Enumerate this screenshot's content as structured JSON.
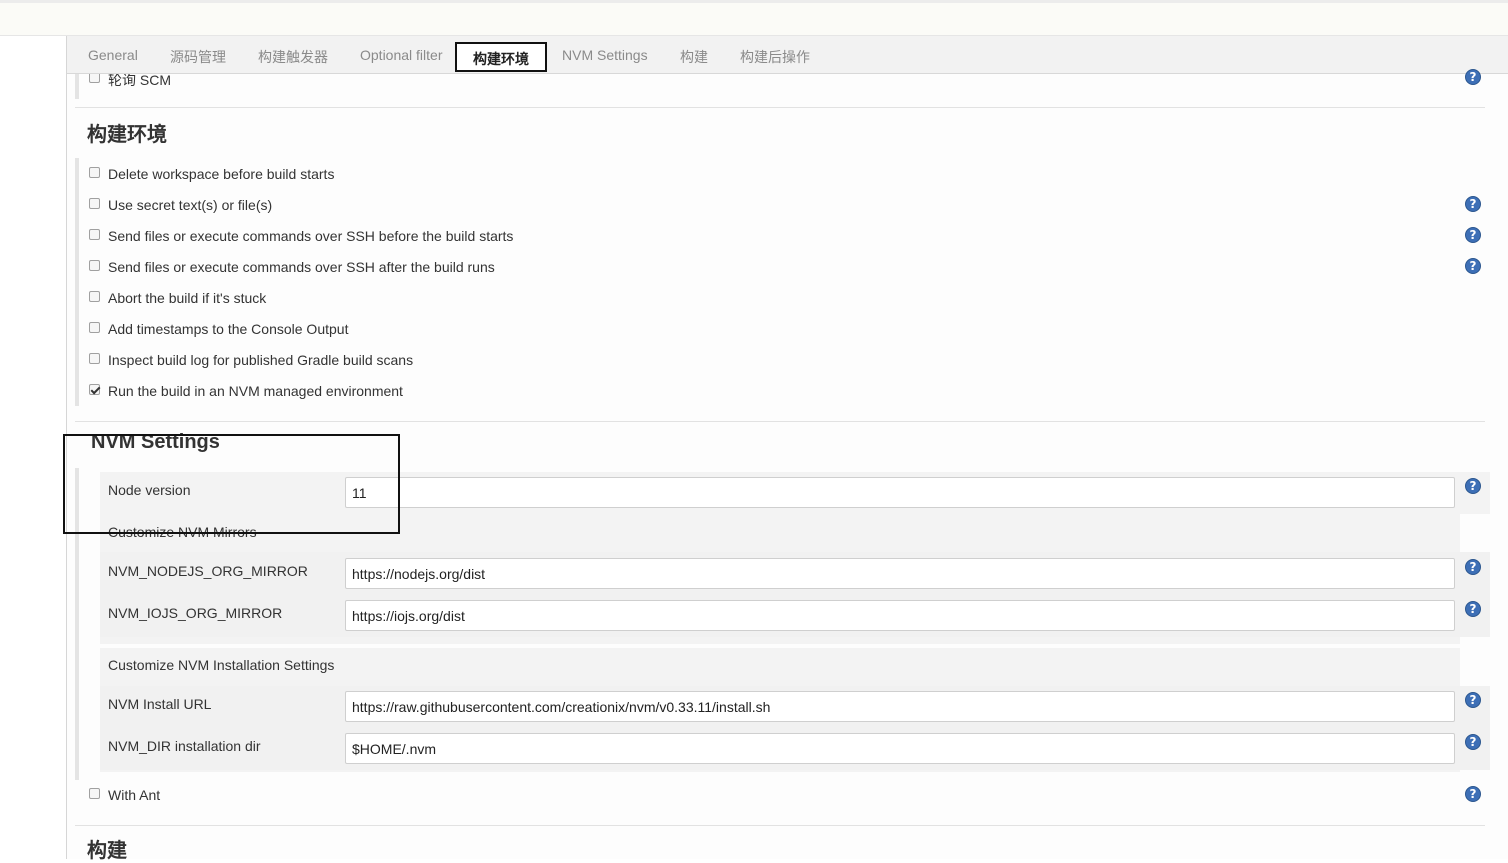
{
  "tabs": [
    "General",
    "源码管理",
    "构建触发器",
    "Optional filter",
    "构建环境",
    "NVM Settings",
    "构建",
    "构建后操作"
  ],
  "poll_scm_label": "轮询 SCM",
  "build_env": {
    "title": "构建环境",
    "options": [
      {
        "label": "Delete workspace before build starts",
        "checked": false
      },
      {
        "label": "Use secret text(s) or file(s)",
        "checked": false
      },
      {
        "label": "Send files or execute commands over SSH before the build starts",
        "checked": false
      },
      {
        "label": "Send files or execute commands over SSH after the build runs",
        "checked": false
      },
      {
        "label": "Abort the build if it's stuck",
        "checked": false
      },
      {
        "label": "Add timestamps to the Console Output",
        "checked": false
      },
      {
        "label": "Inspect build log for published Gradle build scans",
        "checked": false
      },
      {
        "label": "Run the build in an NVM managed environment",
        "checked": true
      }
    ]
  },
  "nvm": {
    "title": "NVM Settings",
    "node_version_label": "Node version",
    "node_version_value": "11",
    "mirrors_heading": "Customize NVM Mirrors",
    "nodejs_mirror_label": "NVM_NODEJS_ORG_MIRROR",
    "nodejs_mirror_value": "https://nodejs.org/dist",
    "iojs_mirror_label": "NVM_IOJS_ORG_MIRROR",
    "iojs_mirror_value": "https://iojs.org/dist",
    "install_heading": "Customize NVM Installation Settings",
    "install_url_label": "NVM Install URL",
    "install_url_value": "https://raw.githubusercontent.com/creationix/nvm/v0.33.11/install.sh",
    "nvm_dir_label": "NVM_DIR installation dir",
    "nvm_dir_value": "$HOME/.nvm"
  },
  "with_ant_label": "With Ant",
  "build_title": "构建",
  "help_glyph": "?"
}
